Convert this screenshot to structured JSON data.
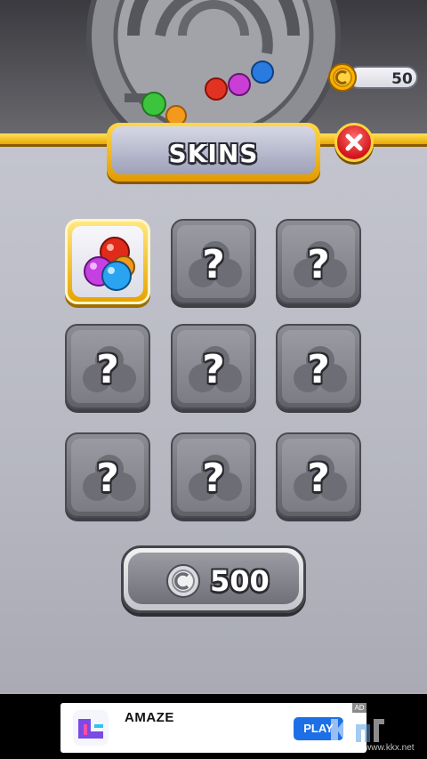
{
  "header": {
    "coins": "50",
    "title": "SKINS"
  },
  "skins": {
    "grid": [
      {
        "id": "skin-1",
        "state": "selected",
        "label": ""
      },
      {
        "id": "skin-2",
        "state": "locked",
        "label": "?"
      },
      {
        "id": "skin-3",
        "state": "locked",
        "label": "?"
      },
      {
        "id": "skin-4",
        "state": "locked",
        "label": "?"
      },
      {
        "id": "skin-5",
        "state": "locked",
        "label": "?"
      },
      {
        "id": "skin-6",
        "state": "locked",
        "label": "?"
      },
      {
        "id": "skin-7",
        "state": "locked",
        "label": "?"
      },
      {
        "id": "skin-8",
        "state": "locked",
        "label": "?"
      },
      {
        "id": "skin-9",
        "state": "locked",
        "label": "?"
      }
    ],
    "unlock_price": "500"
  },
  "ad": {
    "app_name": "AMAZE",
    "cta": "PLAY",
    "badge": "AD"
  },
  "watermark": {
    "text": "www.kkx.net"
  },
  "colors": {
    "gold": "#ffd640",
    "close_red": "#d1161b",
    "tile_gray": "#7b7c84",
    "ad_button": "#1d6fe6"
  }
}
